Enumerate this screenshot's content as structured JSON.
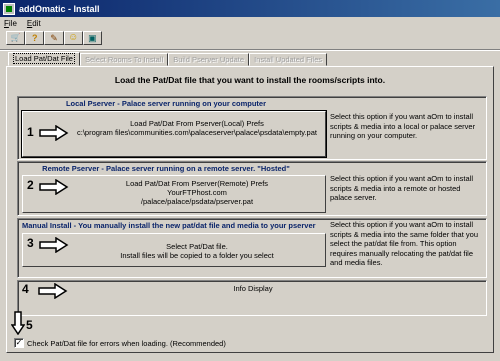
{
  "window": {
    "title": "addOmatic - Install"
  },
  "menu": {
    "file": "File",
    "edit": "Edit"
  },
  "toolbar": {
    "buttons": [
      {
        "icon": "cart-icon",
        "glyph": "🛒"
      },
      {
        "icon": "help-icon",
        "glyph": "?"
      },
      {
        "icon": "wand-icon",
        "glyph": "✎"
      },
      {
        "icon": "smiley-icon",
        "glyph": "☺"
      },
      {
        "icon": "book-icon",
        "glyph": "▣"
      }
    ]
  },
  "tabs": [
    {
      "label": "Load Pat/Dat File",
      "active": true
    },
    {
      "label": "Select Rooms To Install",
      "active": false
    },
    {
      "label": "Build Pserver Update",
      "active": false
    },
    {
      "label": "Install Updated Files",
      "active": false
    }
  ],
  "heading": "Load the Pat/Dat file that you want to install the rooms/scripts into.",
  "sections": [
    {
      "number": "1",
      "title": "Local Pserver - Palace server running on your computer",
      "button_lines": [
        "Load Pat/Dat From Pserver(Local) Prefs",
        "c:\\program files\\communities.com\\palaceserver\\palace\\psdata\\empty.pat"
      ],
      "description": "Select this option if you want aOm to install scripts & media into a local or palace server running on your computer."
    },
    {
      "number": "2",
      "title": "Remote Pserver - Palace server running on a remote server. \"Hosted\"",
      "button_lines": [
        "Load Pat/Dat From Pserver(Remote) Prefs",
        "YourFTPhost.com",
        "/palace/palace/psdata/pserver.pat"
      ],
      "description": "Select this option if you want aOm to install scripts & media into a remote or hosted palace server."
    },
    {
      "number": "3",
      "title": "Manual Install - You manually install the new pat/dat file and media to your pserver",
      "button_lines": [
        "Select Pat/Dat file.",
        "Install files will be copied to a folder you select"
      ],
      "description": "Select this option if you want aOm to install scripts & media into the same folder that you select the pat/dat file from. This option requires manually relocating the pat/dat file and media files."
    }
  ],
  "info": {
    "number": "4",
    "title": "Info Display"
  },
  "step5": {
    "number": "5"
  },
  "checkbox": {
    "checked": true,
    "mark": "✓",
    "label": "Check Pat/Dat file for errors when loading. (Recommended)"
  }
}
